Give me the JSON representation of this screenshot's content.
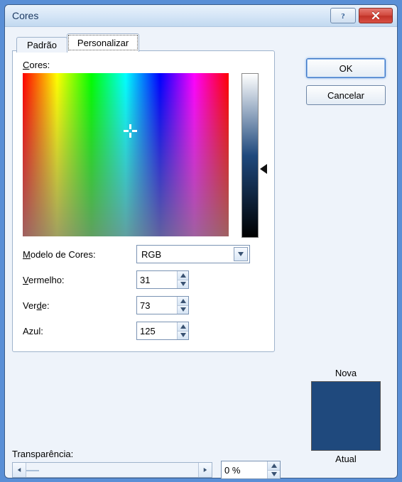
{
  "window": {
    "title": "Cores"
  },
  "tabs": {
    "default": "Padrão",
    "custom": "Personalizar"
  },
  "labels": {
    "cores": "Cores:",
    "modelo": "Modelo de Cores:",
    "vermelho_pre": "V",
    "vermelho_post": "ermelho:",
    "verde_pre": "Ver",
    "verde_u": "d",
    "verde_post": "e:",
    "azul": "Azul:",
    "transparencia_pre": "T",
    "transparencia_post": "ransparência:",
    "nova": "Nova",
    "atual": "Atual"
  },
  "model": {
    "selected": "RGB"
  },
  "values": {
    "r": "31",
    "g": "73",
    "b": "125",
    "transparency": "0 %"
  },
  "buttons": {
    "ok": "OK",
    "cancel": "Cancelar"
  },
  "preview": {
    "color": "#1F497D"
  }
}
